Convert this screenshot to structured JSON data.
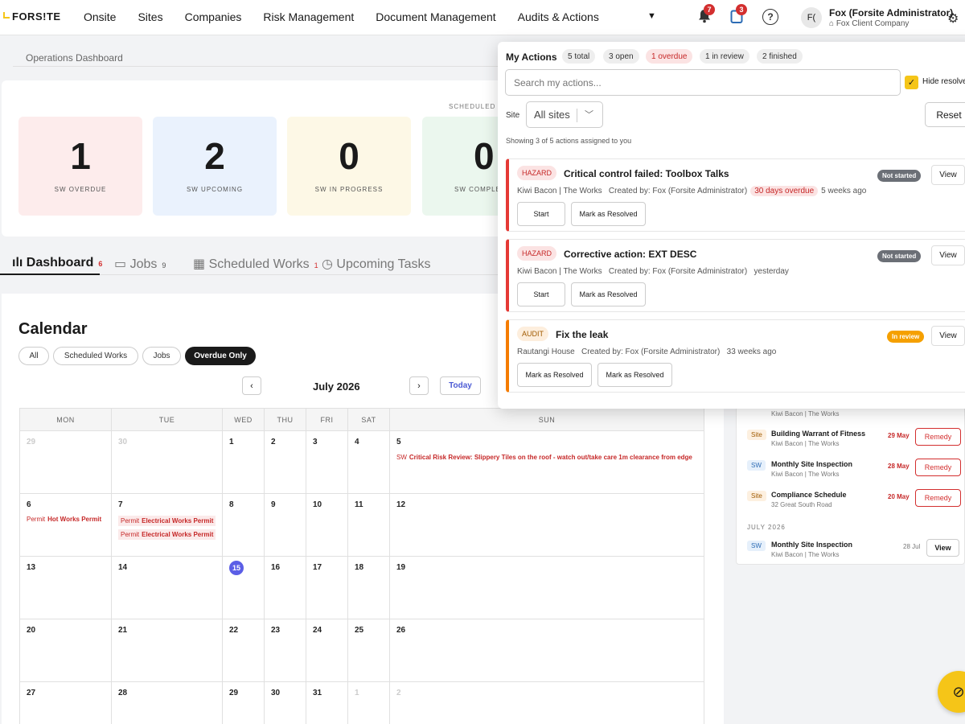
{
  "nav": {
    "logo": "FORS!TE",
    "items": [
      "Onsite",
      "Sites",
      "Companies",
      "Risk Management",
      "Document Management",
      "Audits & Actions"
    ],
    "bell_count": "7",
    "clip_count": "3",
    "help": "?",
    "avatar": "F(",
    "user_name": "Fox (Forsite Administrator)",
    "user_company": "Fox Client Company"
  },
  "dashboard": {
    "title": "Operations Dashboard",
    "scheduled_label": "SCHEDULED W",
    "stats": [
      {
        "value": "1",
        "label": "SW OVERDUE",
        "color": "#fdecec"
      },
      {
        "value": "2",
        "label": "SW UPCOMING",
        "color": "#eaf2fd"
      },
      {
        "value": "0",
        "label": "SW IN PROGRESS",
        "color": "#fdf8e6"
      },
      {
        "value": "0",
        "label": "SW COMPLE",
        "color": "#ebf7ee"
      }
    ],
    "tabs": [
      {
        "label": "Dashboard",
        "count": "6"
      },
      {
        "label": "Jobs",
        "count": "9"
      },
      {
        "label": "Scheduled Works",
        "count": "1"
      },
      {
        "label": "Upcoming Tasks"
      }
    ]
  },
  "calendar": {
    "title": "Calendar",
    "filters": [
      "All",
      "Scheduled Works",
      "Jobs",
      "Overdue Only"
    ],
    "month": "July 2026",
    "today_label": "Today",
    "weekdays": [
      "MON",
      "TUE",
      "WED",
      "THU",
      "FRI",
      "SAT",
      "SUN"
    ],
    "weeks": [
      [
        "29",
        "30",
        "1",
        "2",
        "3",
        "4",
        "5"
      ],
      [
        "6",
        "7",
        "8",
        "9",
        "10",
        "11",
        "12"
      ],
      [
        "13",
        "14",
        "15",
        "16",
        "17",
        "18",
        "19"
      ],
      [
        "20",
        "21",
        "22",
        "23",
        "24",
        "25",
        "26"
      ],
      [
        "27",
        "28",
        "29",
        "30",
        "31",
        "1",
        "2"
      ]
    ],
    "events": {
      "sun5": {
        "tag": "SW",
        "text": "Critical Risk Review: Slippery Tiles on the roof - watch out/take care 1m clearance from edge"
      },
      "mon6": {
        "tag": "Permit",
        "text": "Hot Works Permit"
      },
      "tue7a": {
        "tag": "Permit",
        "text": "Electrical Works Permit"
      },
      "tue7b": {
        "tag": "Permit",
        "text": "Electrical Works Permit"
      }
    }
  },
  "side_list": {
    "partial_sub": "Kiwi Bacon | The Works",
    "items": [
      {
        "tag": "Site",
        "title": "Building Warrant of Fitness",
        "sub": "Kiwi Bacon | The Works",
        "date": "29 May",
        "action": "Remedy"
      },
      {
        "tag": "SW",
        "title": "Monthly Site Inspection",
        "sub": "Kiwi Bacon | The Works",
        "date": "28 May",
        "action": "Remedy"
      },
      {
        "tag": "Site",
        "title": "Compliance Schedule",
        "sub": "32 Great South Road",
        "date": "20 May",
        "action": "Remedy"
      }
    ],
    "section": "JULY 2026",
    "july_item": {
      "tag": "SW",
      "title": "Monthly Site Inspection",
      "sub": "Kiwi Bacon | The Works",
      "date": "28 Jul",
      "action": "View"
    }
  },
  "actions": {
    "title": "My Actions",
    "chips": [
      "5 total",
      "3 open",
      "1 overdue",
      "1 in review",
      "2 finished"
    ],
    "search_placeholder": "Search my actions...",
    "hide_label": "Hide resolved",
    "site_label": "Site",
    "site_value": "All sites",
    "reset": "Reset",
    "showing": "Showing 3 of 5 actions assigned to you",
    "cards": [
      {
        "tag": "HAZARD",
        "title": "Critical control failed: Toolbox Talks",
        "meta_a": "Kiwi Bacon | The Works   Created by: Fox (Forsite Administrator)",
        "overdue": "30 days overdue",
        "meta_b": "5 weeks ago",
        "status": "Not started",
        "view": "View",
        "btn1": "Start",
        "btn2": "Mark as Resolved"
      },
      {
        "tag": "HAZARD",
        "title": "Corrective action: EXT DESC",
        "meta_a": "Kiwi Bacon | The Works   Created by: Fox (Forsite Administrator)   yesterday",
        "status": "Not started",
        "view": "View",
        "btn1": "Start",
        "btn2": "Mark as Resolved"
      },
      {
        "tag": "AUDIT",
        "title": "Fix the leak",
        "meta_a": "Rautangi House   Created by: Fox (Forsite Administrator)   33 weeks ago",
        "status": "In review",
        "view": "View",
        "btn1": "Mark as Resolved",
        "btn2": "Mark as Resolved"
      }
    ]
  }
}
